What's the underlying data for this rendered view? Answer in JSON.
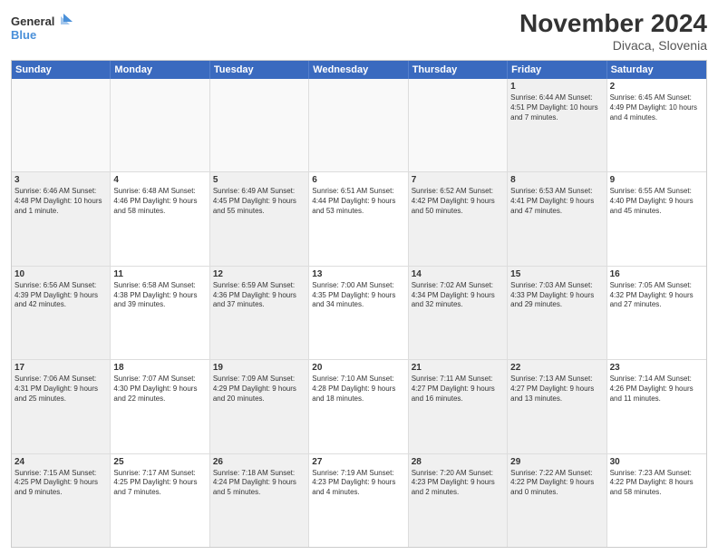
{
  "logo": {
    "line1": "General",
    "line2": "Blue"
  },
  "header": {
    "month": "November 2024",
    "location": "Divaca, Slovenia"
  },
  "weekdays": [
    "Sunday",
    "Monday",
    "Tuesday",
    "Wednesday",
    "Thursday",
    "Friday",
    "Saturday"
  ],
  "rows": [
    [
      {
        "day": "",
        "info": "",
        "empty": true
      },
      {
        "day": "",
        "info": "",
        "empty": true
      },
      {
        "day": "",
        "info": "",
        "empty": true
      },
      {
        "day": "",
        "info": "",
        "empty": true
      },
      {
        "day": "",
        "info": "",
        "empty": true
      },
      {
        "day": "1",
        "info": "Sunrise: 6:44 AM\nSunset: 4:51 PM\nDaylight: 10 hours and 7 minutes.",
        "shaded": true
      },
      {
        "day": "2",
        "info": "Sunrise: 6:45 AM\nSunset: 4:49 PM\nDaylight: 10 hours and 4 minutes.",
        "shaded": false
      }
    ],
    [
      {
        "day": "3",
        "info": "Sunrise: 6:46 AM\nSunset: 4:48 PM\nDaylight: 10 hours and 1 minute.",
        "shaded": true
      },
      {
        "day": "4",
        "info": "Sunrise: 6:48 AM\nSunset: 4:46 PM\nDaylight: 9 hours and 58 minutes.",
        "shaded": false
      },
      {
        "day": "5",
        "info": "Sunrise: 6:49 AM\nSunset: 4:45 PM\nDaylight: 9 hours and 55 minutes.",
        "shaded": true
      },
      {
        "day": "6",
        "info": "Sunrise: 6:51 AM\nSunset: 4:44 PM\nDaylight: 9 hours and 53 minutes.",
        "shaded": false
      },
      {
        "day": "7",
        "info": "Sunrise: 6:52 AM\nSunset: 4:42 PM\nDaylight: 9 hours and 50 minutes.",
        "shaded": true
      },
      {
        "day": "8",
        "info": "Sunrise: 6:53 AM\nSunset: 4:41 PM\nDaylight: 9 hours and 47 minutes.",
        "shaded": true
      },
      {
        "day": "9",
        "info": "Sunrise: 6:55 AM\nSunset: 4:40 PM\nDaylight: 9 hours and 45 minutes.",
        "shaded": false
      }
    ],
    [
      {
        "day": "10",
        "info": "Sunrise: 6:56 AM\nSunset: 4:39 PM\nDaylight: 9 hours and 42 minutes.",
        "shaded": true
      },
      {
        "day": "11",
        "info": "Sunrise: 6:58 AM\nSunset: 4:38 PM\nDaylight: 9 hours and 39 minutes.",
        "shaded": false
      },
      {
        "day": "12",
        "info": "Sunrise: 6:59 AM\nSunset: 4:36 PM\nDaylight: 9 hours and 37 minutes.",
        "shaded": true
      },
      {
        "day": "13",
        "info": "Sunrise: 7:00 AM\nSunset: 4:35 PM\nDaylight: 9 hours and 34 minutes.",
        "shaded": false
      },
      {
        "day": "14",
        "info": "Sunrise: 7:02 AM\nSunset: 4:34 PM\nDaylight: 9 hours and 32 minutes.",
        "shaded": true
      },
      {
        "day": "15",
        "info": "Sunrise: 7:03 AM\nSunset: 4:33 PM\nDaylight: 9 hours and 29 minutes.",
        "shaded": true
      },
      {
        "day": "16",
        "info": "Sunrise: 7:05 AM\nSunset: 4:32 PM\nDaylight: 9 hours and 27 minutes.",
        "shaded": false
      }
    ],
    [
      {
        "day": "17",
        "info": "Sunrise: 7:06 AM\nSunset: 4:31 PM\nDaylight: 9 hours and 25 minutes.",
        "shaded": true
      },
      {
        "day": "18",
        "info": "Sunrise: 7:07 AM\nSunset: 4:30 PM\nDaylight: 9 hours and 22 minutes.",
        "shaded": false
      },
      {
        "day": "19",
        "info": "Sunrise: 7:09 AM\nSunset: 4:29 PM\nDaylight: 9 hours and 20 minutes.",
        "shaded": true
      },
      {
        "day": "20",
        "info": "Sunrise: 7:10 AM\nSunset: 4:28 PM\nDaylight: 9 hours and 18 minutes.",
        "shaded": false
      },
      {
        "day": "21",
        "info": "Sunrise: 7:11 AM\nSunset: 4:27 PM\nDaylight: 9 hours and 16 minutes.",
        "shaded": true
      },
      {
        "day": "22",
        "info": "Sunrise: 7:13 AM\nSunset: 4:27 PM\nDaylight: 9 hours and 13 minutes.",
        "shaded": true
      },
      {
        "day": "23",
        "info": "Sunrise: 7:14 AM\nSunset: 4:26 PM\nDaylight: 9 hours and 11 minutes.",
        "shaded": false
      }
    ],
    [
      {
        "day": "24",
        "info": "Sunrise: 7:15 AM\nSunset: 4:25 PM\nDaylight: 9 hours and 9 minutes.",
        "shaded": true
      },
      {
        "day": "25",
        "info": "Sunrise: 7:17 AM\nSunset: 4:25 PM\nDaylight: 9 hours and 7 minutes.",
        "shaded": false
      },
      {
        "day": "26",
        "info": "Sunrise: 7:18 AM\nSunset: 4:24 PM\nDaylight: 9 hours and 5 minutes.",
        "shaded": true
      },
      {
        "day": "27",
        "info": "Sunrise: 7:19 AM\nSunset: 4:23 PM\nDaylight: 9 hours and 4 minutes.",
        "shaded": false
      },
      {
        "day": "28",
        "info": "Sunrise: 7:20 AM\nSunset: 4:23 PM\nDaylight: 9 hours and 2 minutes.",
        "shaded": true
      },
      {
        "day": "29",
        "info": "Sunrise: 7:22 AM\nSunset: 4:22 PM\nDaylight: 9 hours and 0 minutes.",
        "shaded": true
      },
      {
        "day": "30",
        "info": "Sunrise: 7:23 AM\nSunset: 4:22 PM\nDaylight: 8 hours and 58 minutes.",
        "shaded": false
      }
    ]
  ]
}
